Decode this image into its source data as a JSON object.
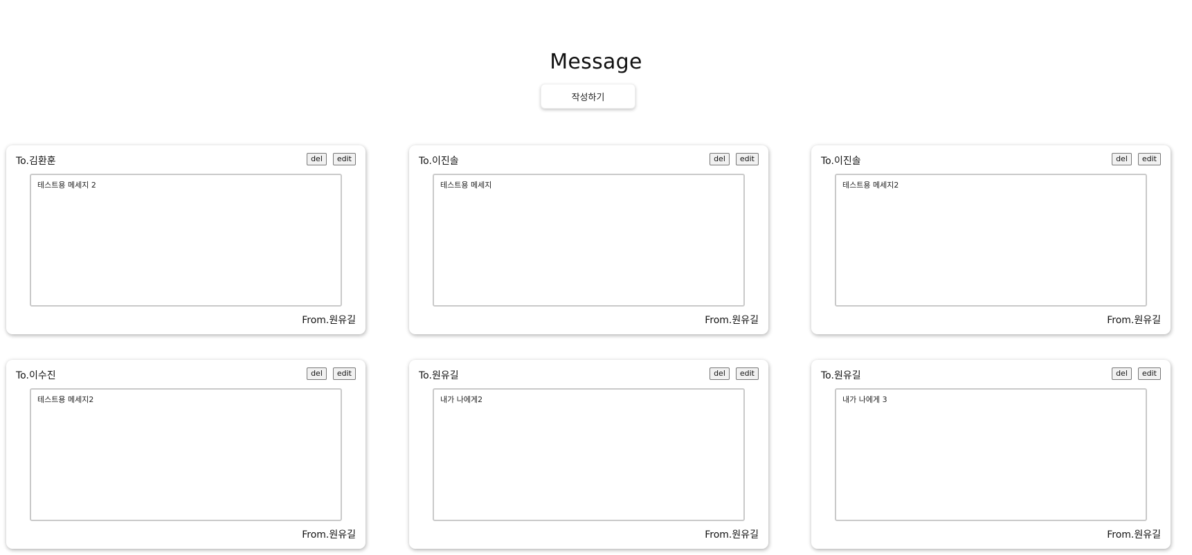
{
  "header": {
    "title": "Message",
    "compose_label": "작성하기"
  },
  "cards": [
    {
      "to": "To.김환훈",
      "del_label": "del",
      "edit_label": "edit",
      "body": "테스트용 메세지 2",
      "from": "From.원유길"
    },
    {
      "to": "To.이진솔",
      "del_label": "del",
      "edit_label": "edit",
      "body": "테스트용 메세지",
      "from": "From.원유길"
    },
    {
      "to": "To.이진솔",
      "del_label": "del",
      "edit_label": "edit",
      "body": "테스트용 메세지2",
      "from": "From.원유길"
    },
    {
      "to": "To.이수진",
      "del_label": "del",
      "edit_label": "edit",
      "body": "테스트용 메세지2",
      "from": "From.원유길"
    },
    {
      "to": "To.원유길",
      "del_label": "del",
      "edit_label": "edit",
      "body": "내가 나에게2",
      "from": "From.원유길"
    },
    {
      "to": "To.원유길",
      "del_label": "del",
      "edit_label": "edit",
      "body": "내가 나에게 3",
      "from": "From.원유길"
    }
  ]
}
